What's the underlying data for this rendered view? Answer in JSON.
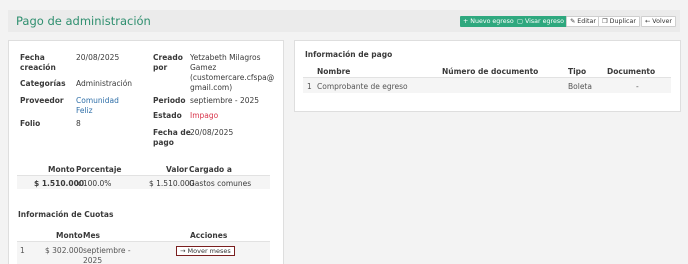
{
  "page": {
    "title": "Pago de administración",
    "actions": {
      "new_expense": "+ Nuevo egreso",
      "view_expense": "Visar egreso",
      "edit": "Editar",
      "duplicate": "Duplicar",
      "back": "Volver"
    }
  },
  "details": {
    "fecha_creacion": {
      "label1": "Fecha",
      "label2": "creación",
      "value": "20/08/2025"
    },
    "categorias": {
      "label": "Categorías",
      "value": "Administración"
    },
    "proveedor": {
      "label": "Proveedor",
      "value1": "Comunidad",
      "value2": "Feliz"
    },
    "folio": {
      "label": "Folio",
      "value": "8"
    },
    "creado_por": {
      "label1": "Creado",
      "label2": "por",
      "lines": [
        "Yetzabeth Milagros",
        "Gamez",
        "(customercare.cfspa@",
        "gmail.com)"
      ]
    },
    "periodo": {
      "label": "Periodo",
      "value": "septiembre - 2025"
    },
    "estado": {
      "label": "Estado",
      "value": "Impago"
    },
    "fecha_pago": {
      "label1": "Fecha de",
      "label2": "pago",
      "value": "20/08/2025"
    }
  },
  "amounts_table": {
    "headers": [
      "Monto",
      "Porcentaje",
      "Valor",
      "Cargado a"
    ],
    "row": [
      "$ 1.510.000",
      "x 100.0%",
      "$ 1.510.000",
      "Gastos comunes"
    ]
  },
  "cuotas": {
    "title": "Información de Cuotas",
    "headers": [
      "Monto",
      "Mes",
      "Acciones"
    ],
    "row": {
      "index": "1",
      "monto": "$ 302.000",
      "mes1": "septiembre -",
      "mes2": "2025",
      "action": "→ Mover meses"
    }
  },
  "payment_info": {
    "title": "Información de pago",
    "headers": [
      "Nombre",
      "Número de documento",
      "Tipo",
      "Documento"
    ],
    "row": [
      "1",
      "Comprobante de egreso",
      "",
      "Boleta",
      "-"
    ]
  }
}
